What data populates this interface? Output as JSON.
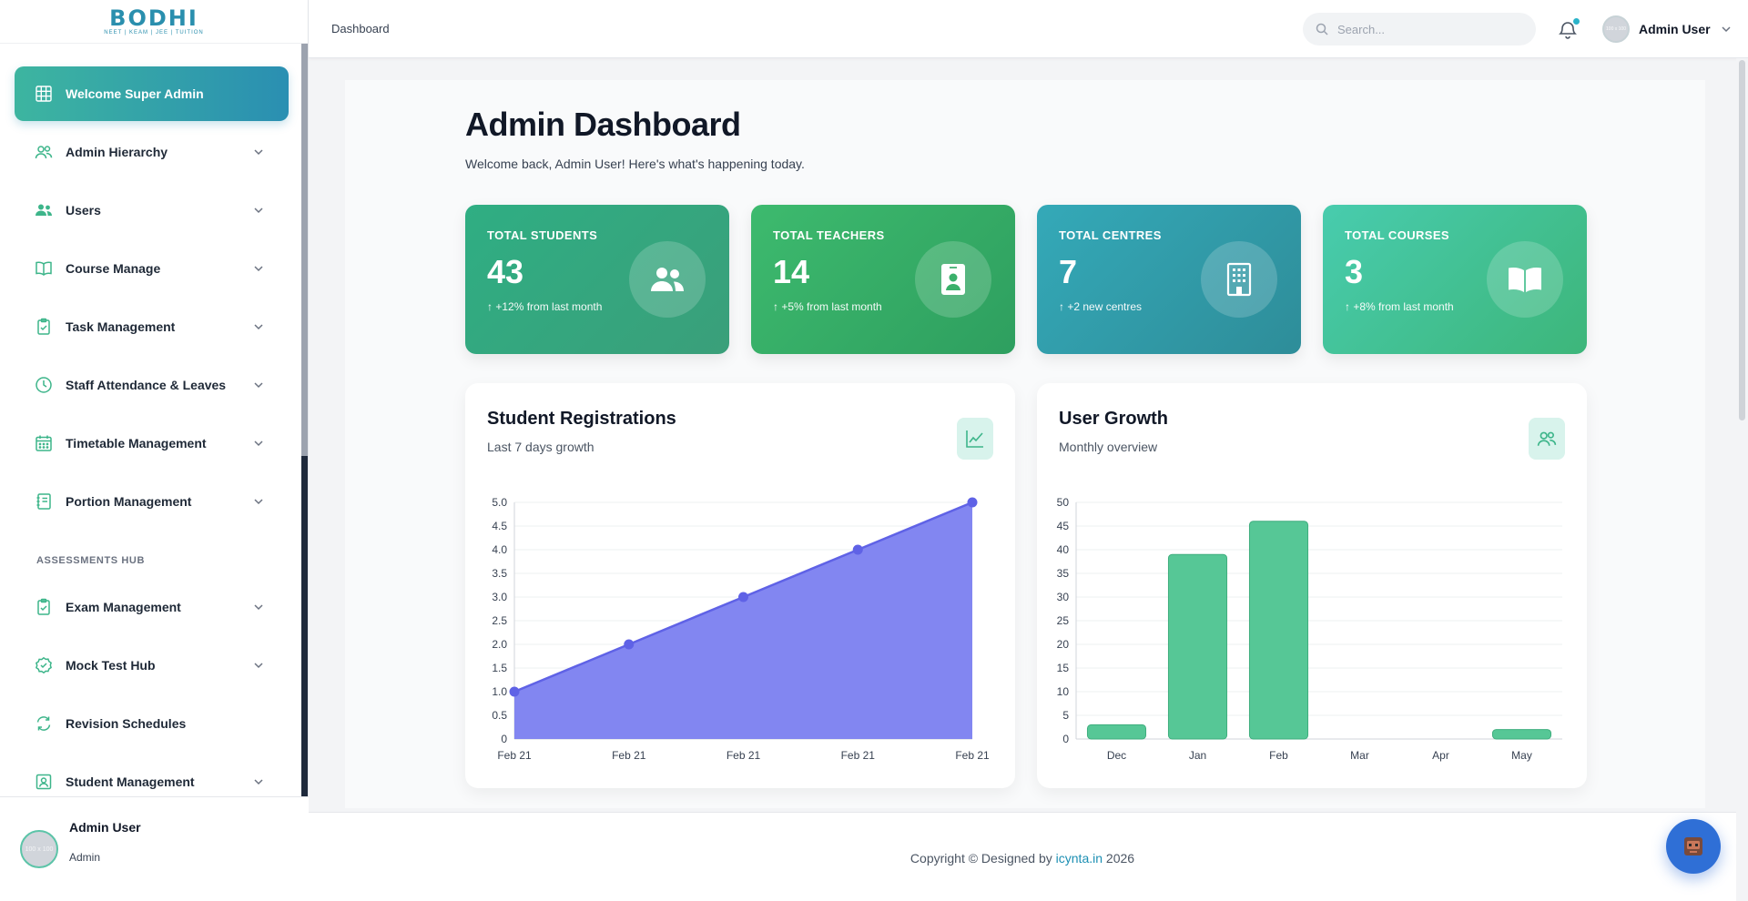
{
  "brand": {
    "logo_text": "BODHI",
    "logo_sub": "NEET | KEAM | JEE | TUITION"
  },
  "sidebar": {
    "active_item": {
      "label": "Welcome Super Admin",
      "icon": "grid-icon"
    },
    "items": [
      {
        "label": "Admin Hierarchy",
        "icon": "users-outline-icon",
        "has_children": true
      },
      {
        "label": "Users",
        "icon": "users-icon",
        "has_children": true
      },
      {
        "label": "Course Manage",
        "icon": "book-open-icon",
        "has_children": true
      },
      {
        "label": "Task Management",
        "icon": "clipboard-check-icon",
        "has_children": true
      },
      {
        "label": "Staff Attendance & Leaves",
        "icon": "clock-icon",
        "has_children": true
      },
      {
        "label": "Timetable Management",
        "icon": "calendar-icon",
        "has_children": true
      },
      {
        "label": "Portion Management",
        "icon": "notebook-icon",
        "has_children": true
      }
    ],
    "section_label": "ASSESSMENTS HUB",
    "section_items": [
      {
        "label": "Exam Management",
        "icon": "clipboard-check-icon",
        "has_children": true
      },
      {
        "label": "Mock Test Hub",
        "icon": "badge-check-icon",
        "has_children": true
      },
      {
        "label": "Revision Schedules",
        "icon": "refresh-icon",
        "has_children": false
      },
      {
        "label": "Student Management",
        "icon": "id-card-icon",
        "has_children": true
      }
    ],
    "footer_user": {
      "name": "Admin User",
      "role": "Admin",
      "avatar_text": "100 x 100"
    }
  },
  "header": {
    "breadcrumb": "Dashboard",
    "search_placeholder": "Search...",
    "user_name": "Admin User",
    "avatar_text": "100 x 100"
  },
  "main": {
    "title": "Admin Dashboard",
    "subtitle": "Welcome back, Admin User! Here's what's happening today.",
    "stats": [
      {
        "label": "TOTAL STUDENTS",
        "value": "43",
        "trend": "↑ +12% from last month",
        "icon": "users-icon",
        "color_from": "#2fae83",
        "color_to": "#3a9f7a"
      },
      {
        "label": "TOTAL TEACHERS",
        "value": "14",
        "trend": "↑ +5% from last month",
        "icon": "id-badge-icon",
        "color_from": "#3dba6e",
        "color_to": "#2e9f5f"
      },
      {
        "label": "TOTAL CENTRES",
        "value": "7",
        "trend": "↑ +2 new centres",
        "icon": "building-icon",
        "color_from": "#34a9b8",
        "color_to": "#2e8d99"
      },
      {
        "label": "TOTAL COURSES",
        "value": "3",
        "trend": "↑ +8% from last month",
        "icon": "book-icon",
        "color_from": "#48ccae",
        "color_to": "#3db67a"
      }
    ]
  },
  "chart_data": [
    {
      "type": "area",
      "title": "Student Registrations",
      "subtitle": "Last 7 days growth",
      "icon": "trending-up-icon",
      "categories": [
        "Feb 21",
        "Feb 21",
        "Feb 21",
        "Feb 21",
        "Feb 21"
      ],
      "values": [
        1,
        2,
        3,
        4,
        5
      ],
      "ylim": [
        0,
        5
      ],
      "yticks": [
        "0",
        "0.5",
        "1.0",
        "1.5",
        "2.0",
        "2.5",
        "3.0",
        "3.5",
        "4.0",
        "4.5",
        "5.0"
      ],
      "color": "#7b7ff0",
      "line_color": "#5f62e6",
      "grid": true
    },
    {
      "type": "bar",
      "title": "User Growth",
      "subtitle": "Monthly overview",
      "icon": "users-outline-icon",
      "categories": [
        "Dec",
        "Jan",
        "Feb",
        "Mar",
        "Apr",
        "May"
      ],
      "values": [
        3,
        39,
        46,
        0,
        0,
        2
      ],
      "ylim": [
        0,
        50
      ],
      "yticks": [
        "0",
        "5",
        "10",
        "15",
        "20",
        "25",
        "30",
        "35",
        "40",
        "45",
        "50"
      ],
      "color": "#56c796",
      "grid": true
    }
  ],
  "footer": {
    "prefix": "Copyright © Designed by ",
    "link": "icynta.in",
    "suffix": " 2026"
  }
}
